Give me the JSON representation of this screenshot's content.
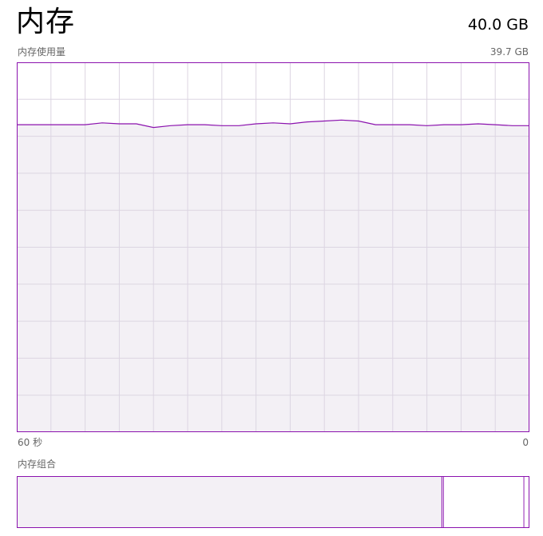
{
  "memory": {
    "title": "内存",
    "total": "40.0 GB",
    "usage_label": "内存使用量",
    "usage_max": "39.7 GB",
    "time_start": "60 秒",
    "time_end": "0",
    "composition_label": "内存组合"
  },
  "colors": {
    "accent": "#8b12ae",
    "fill": "#f3f0f5",
    "grid": "#dcd5e2",
    "text_secondary": "#666666"
  },
  "chart_data": {
    "type": "area",
    "title": "",
    "xlabel": "",
    "ylabel": "",
    "x": [
      60,
      58,
      56,
      54,
      52,
      50,
      48,
      46,
      44,
      42,
      40,
      38,
      36,
      34,
      32,
      30,
      28,
      26,
      24,
      22,
      20,
      18,
      16,
      14,
      12,
      10,
      8,
      6,
      4,
      2,
      0
    ],
    "xlim": [
      60,
      0
    ],
    "ylim": [
      0,
      39.7
    ],
    "series": [
      {
        "values": [
          33.0,
          33.0,
          33.0,
          33.0,
          33.0,
          33.2,
          33.1,
          33.1,
          32.7,
          32.9,
          33.0,
          33.0,
          32.9,
          32.9,
          33.1,
          33.2,
          33.1,
          33.3,
          33.4,
          33.5,
          33.4,
          33.0,
          33.0,
          33.0,
          32.9,
          33.0,
          33.0,
          33.1,
          33.0,
          32.9,
          32.9
        ]
      }
    ],
    "grid": true
  },
  "composition": {
    "in_use_fraction": 0.83,
    "standby_fraction": 0.16,
    "free_fraction": 0.01
  }
}
